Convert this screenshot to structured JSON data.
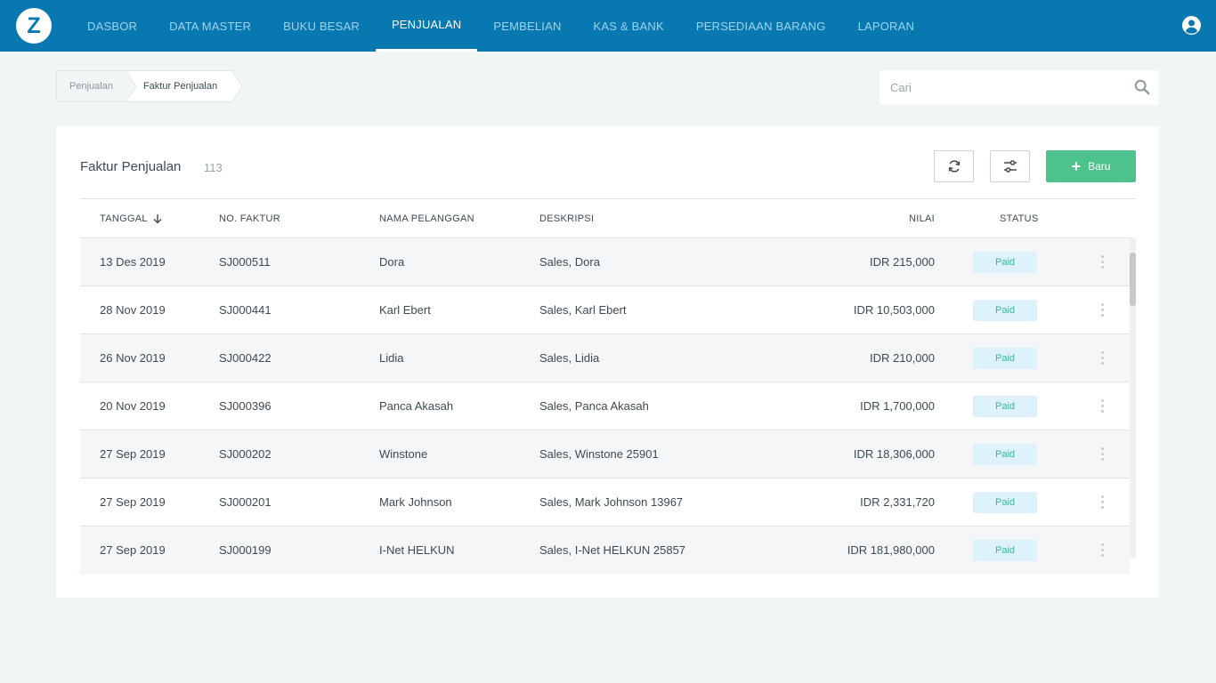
{
  "app": {
    "logo_letter": "Z",
    "brand_color": "#0778b0",
    "accent_color": "#4ec28d"
  },
  "nav": {
    "items": [
      {
        "label": "DASBOR"
      },
      {
        "label": "DATA MASTER"
      },
      {
        "label": "BUKU BESAR"
      },
      {
        "label": "PENJUALAN",
        "active": true
      },
      {
        "label": "PEMBELIAN"
      },
      {
        "label": "KAS & BANK"
      },
      {
        "label": "PERSEDIAAN BARANG"
      },
      {
        "label": "LAPORAN"
      }
    ],
    "user_icon": "user-circle-icon"
  },
  "breadcrumb": {
    "items": [
      "Penjualan",
      "Faktur Penjualan"
    ]
  },
  "search": {
    "placeholder": "Cari",
    "icon": "search-icon"
  },
  "main": {
    "title": "Faktur Penjualan",
    "count": "113",
    "refresh_icon": "refresh-icon",
    "filter_icon": "filter-sliders-icon",
    "new_button_label": "Baru",
    "table": {
      "columns": [
        "TANGGAL",
        "NO. FAKTUR",
        "NAMA PELANGGAN",
        "DESKRIPSI",
        "NILAI",
        "STATUS"
      ],
      "sort_icon": "arrow-down-icon",
      "rows": [
        {
          "date": "13 Des 2019",
          "number": "SJ000511",
          "customer": "Dora",
          "description": "Sales, Dora",
          "value": "IDR 215,000",
          "status": "Paid"
        },
        {
          "date": "28 Nov 2019",
          "number": "SJ000441",
          "customer": "Karl Ebert",
          "description": "Sales, Karl Ebert",
          "value": "IDR 10,503,000",
          "status": "Paid"
        },
        {
          "date": "26 Nov 2019",
          "number": "SJ000422",
          "customer": "Lidia",
          "description": "Sales, Lidia",
          "value": "IDR 210,000",
          "status": "Paid"
        },
        {
          "date": "20 Nov 2019",
          "number": "SJ000396",
          "customer": "Panca Akasah",
          "description": "Sales, Panca Akasah",
          "value": "IDR 1,700,000",
          "status": "Paid"
        },
        {
          "date": "27 Sep 2019",
          "number": "SJ000202",
          "customer": "Winstone",
          "description": "Sales, Winstone 25901",
          "value": "IDR 18,306,000",
          "status": "Paid"
        },
        {
          "date": "27 Sep 2019",
          "number": "SJ000201",
          "customer": "Mark Johnson",
          "description": "Sales, Mark Johnson 13967",
          "value": "IDR 2,331,720",
          "status": "Paid"
        },
        {
          "date": "27 Sep 2019",
          "number": "SJ000199",
          "customer": "I-Net HELKUN",
          "description": "Sales, I-Net HELKUN 25857",
          "value": "IDR 181,980,000",
          "status": "Paid"
        }
      ]
    }
  }
}
